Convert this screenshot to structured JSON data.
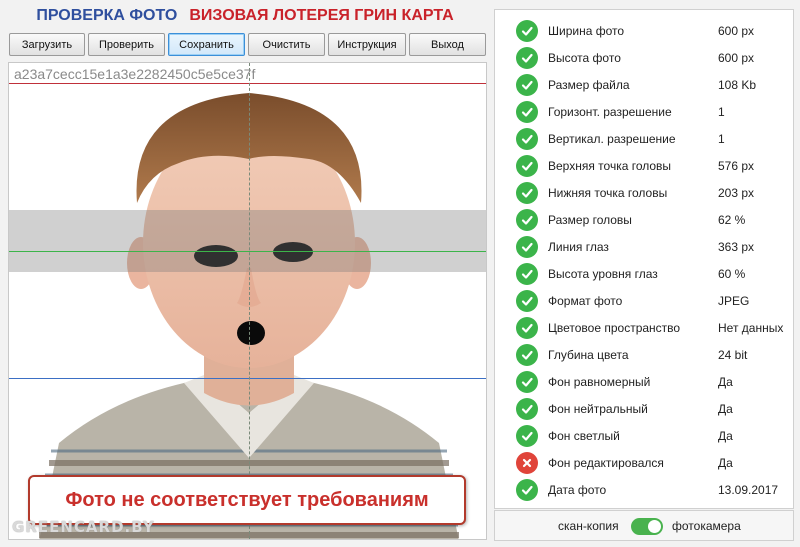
{
  "header": {
    "title_left": "ПРОВЕРКА ФОТО",
    "title_right": "ВИЗОВАЯ ЛОТЕРЕЯ ГРИН КАРТА"
  },
  "toolbar": {
    "buttons": [
      "Загрузить",
      "Проверить",
      "Сохранить",
      "Очистить",
      "Инструкция",
      "Выход"
    ],
    "active": "Сохранить"
  },
  "photo": {
    "hash": "a23a7cecc15e1a3e2282450c5e5ce37f",
    "warning": "Фото не соответствует требованиям",
    "watermark": "GREENCARD.BY"
  },
  "checks": [
    {
      "label": "Ширина фото",
      "value": "600 px",
      "status": "ok"
    },
    {
      "label": "Высота фото",
      "value": "600 px",
      "status": "ok"
    },
    {
      "label": "Размер файла",
      "value": "108 Kb",
      "status": "ok"
    },
    {
      "label": "Горизонт. разрешение",
      "value": "1",
      "status": "ok"
    },
    {
      "label": "Вертикал. разрешение",
      "value": "1",
      "status": "ok"
    },
    {
      "label": "Верхняя точка головы",
      "value": "576 px",
      "status": "ok"
    },
    {
      "label": "Нижняя точка головы",
      "value": "203 px",
      "status": "ok"
    },
    {
      "label": "Размер головы",
      "value": "62 %",
      "status": "ok"
    },
    {
      "label": "Линия глаз",
      "value": "363 px",
      "status": "ok"
    },
    {
      "label": "Высота уровня глаз",
      "value": "60 %",
      "status": "ok"
    },
    {
      "label": "Формат фото",
      "value": "JPEG",
      "status": "ok"
    },
    {
      "label": "Цветовое пространство",
      "value": "Нет данных",
      "status": "ok"
    },
    {
      "label": "Глубина цвета",
      "value": "24 bit",
      "status": "ok"
    },
    {
      "label": "Фон равномерный",
      "value": "Да",
      "status": "ok"
    },
    {
      "label": "Фон нейтральный",
      "value": "Да",
      "status": "ok"
    },
    {
      "label": "Фон светлый",
      "value": "Да",
      "status": "ok"
    },
    {
      "label": "Фон редактировался",
      "value": "Да",
      "status": "error"
    },
    {
      "label": "Дата фото",
      "value": "13.09.2017",
      "status": "ok"
    }
  ],
  "source_toggle": {
    "left_label": "скан-копия",
    "right_label": "фотокамера",
    "state": "фотокамера"
  },
  "colors": {
    "title_blue": "#2f4f9e",
    "title_red": "#c9222a",
    "ok": "#3bb44a",
    "error": "#e0443a",
    "toggle_on": "#49b24e",
    "warning_border": "#b23a2c"
  },
  "icons": {
    "ok": "check-circle-icon",
    "error": "cross-circle-icon"
  }
}
